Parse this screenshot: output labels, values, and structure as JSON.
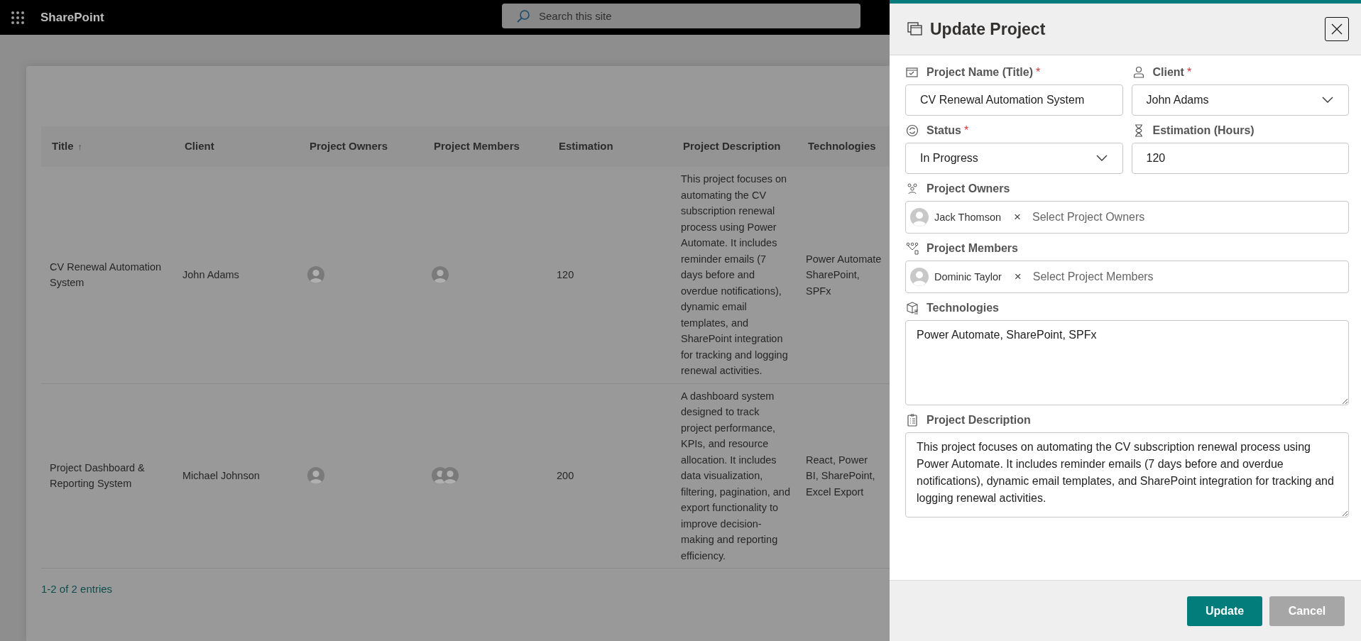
{
  "top_bar": {
    "app_name": "SharePoint",
    "search": {
      "placeholder": "Search this site"
    }
  },
  "table": {
    "columns": [
      {
        "label": "Title",
        "sort_indicator": "↑"
      },
      {
        "label": "Client"
      },
      {
        "label": "Project Owners"
      },
      {
        "label": "Project Members"
      },
      {
        "label": "Estimation"
      },
      {
        "label": "Project Description"
      },
      {
        "label": "Technologies"
      }
    ],
    "rows": [
      {
        "title": "CV Renewal Automation System",
        "client": "John Adams",
        "owners": [
          {
            "photo": false
          }
        ],
        "members": [
          {
            "photo": false
          }
        ],
        "estimation": "120",
        "description": "This project focuses on automating the CV subscription renewal process using Power Automate. It includes reminder emails (7 days before and overdue notifications), dynamic email templates, and SharePoint integration for tracking and logging renewal activities.",
        "technologies": "Power Automate SharePoint, SPFx"
      },
      {
        "title": "Project Dashboard & Reporting System",
        "client": "Michael Johnson",
        "owners": [
          {
            "photo": false
          }
        ],
        "members": [
          {
            "photo": false
          },
          {
            "photo": false
          }
        ],
        "estimation": "200",
        "description": "A dashboard system designed to track project performance, KPIs, and resource allocation. It includes data visualization, filtering, pagination, and export functionality to improve decision-making and reporting efficiency.",
        "technologies": "React, Power BI, SharePoint, Excel Export"
      }
    ],
    "footer": "1-2 of 2 entries"
  },
  "panel": {
    "title": "Update Project",
    "fields": [
      {
        "kind": "text",
        "label": "Project Name (Title)",
        "required_mark": "*",
        "value": "CV Renewal Automation System"
      },
      {
        "kind": "dropdown",
        "label": "Client",
        "required_mark": "*",
        "value": "John Adams"
      },
      {
        "kind": "dropdown",
        "label": "Status",
        "required_mark": "*",
        "value": "In Progress"
      },
      {
        "kind": "text",
        "label": "Estimation (Hours)",
        "value": "120"
      },
      {
        "kind": "people",
        "label": "Project Owners",
        "people": [
          {
            "name": "Jack Thomson",
            "remove": "×"
          }
        ],
        "placeholder": "Select Project Owners"
      },
      {
        "kind": "people",
        "label": "Project Members",
        "people": [
          {
            "name": "Dominic Taylor",
            "remove": "×"
          }
        ],
        "placeholder": "Select Project Members"
      },
      {
        "kind": "textarea",
        "label": "Technologies",
        "value": "Power Automate, SharePoint, SPFx"
      },
      {
        "kind": "textarea",
        "label": "Project Description",
        "value": "This project focuses on automating the CV subscription renewal process using Power Automate. It includes reminder emails (7 days before and overdue notifications), dynamic email templates, and SharePoint integration for tracking and logging renewal activities."
      }
    ],
    "buttons": [
      {
        "label": "Update",
        "kind": "primary"
      },
      {
        "label": "Cancel",
        "kind": "secondary"
      }
    ]
  }
}
